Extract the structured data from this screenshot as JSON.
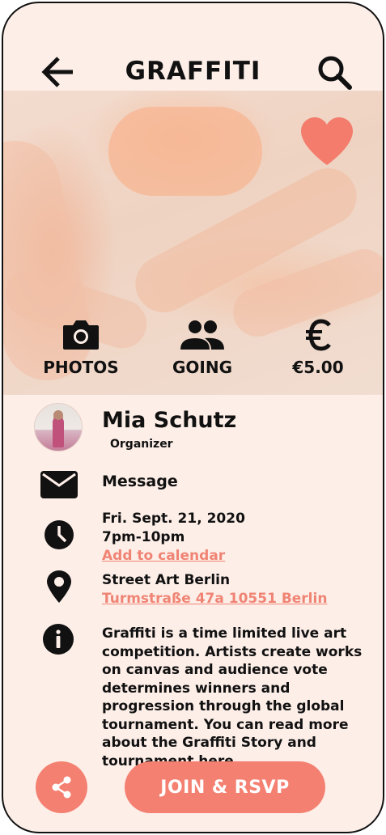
{
  "header": {
    "title": "GRAFFITI",
    "back_icon": "arrow-left-icon",
    "search_icon": "search-icon"
  },
  "hero": {
    "favorite_icon": "heart-icon",
    "stats": [
      {
        "icon": "camera-icon",
        "label": "PHOTOS"
      },
      {
        "icon": "people-icon",
        "label": "GOING"
      },
      {
        "icon": "euro-icon",
        "label": "€5.00"
      }
    ]
  },
  "organizer": {
    "name": "Mia Schutz",
    "role": "Organizer"
  },
  "message": {
    "icon": "mail-icon",
    "label": "Message"
  },
  "schedule": {
    "icon": "clock-icon",
    "date": "Fri. Sept. 21, 2020",
    "time": "7pm-10pm",
    "calendar_link": "Add to calendar"
  },
  "location": {
    "icon": "location-pin-icon",
    "venue": "Street Art Berlin",
    "address": "Turmstraße 47a 10551 Berlin"
  },
  "info": {
    "icon": "info-icon",
    "text": "Graffiti is a time limited live art competition. Artists create works on canvas and audience vote determines winners and progression through the global tournament. You can read more about the Graffiti Story and tournament ",
    "link": "here."
  },
  "actions": {
    "share_icon": "share-icon",
    "join_label": "JOIN & RSVP"
  },
  "colors": {
    "background": "#fdeee8",
    "accent": "#f48071",
    "link": "#f08474",
    "text": "#111111"
  }
}
